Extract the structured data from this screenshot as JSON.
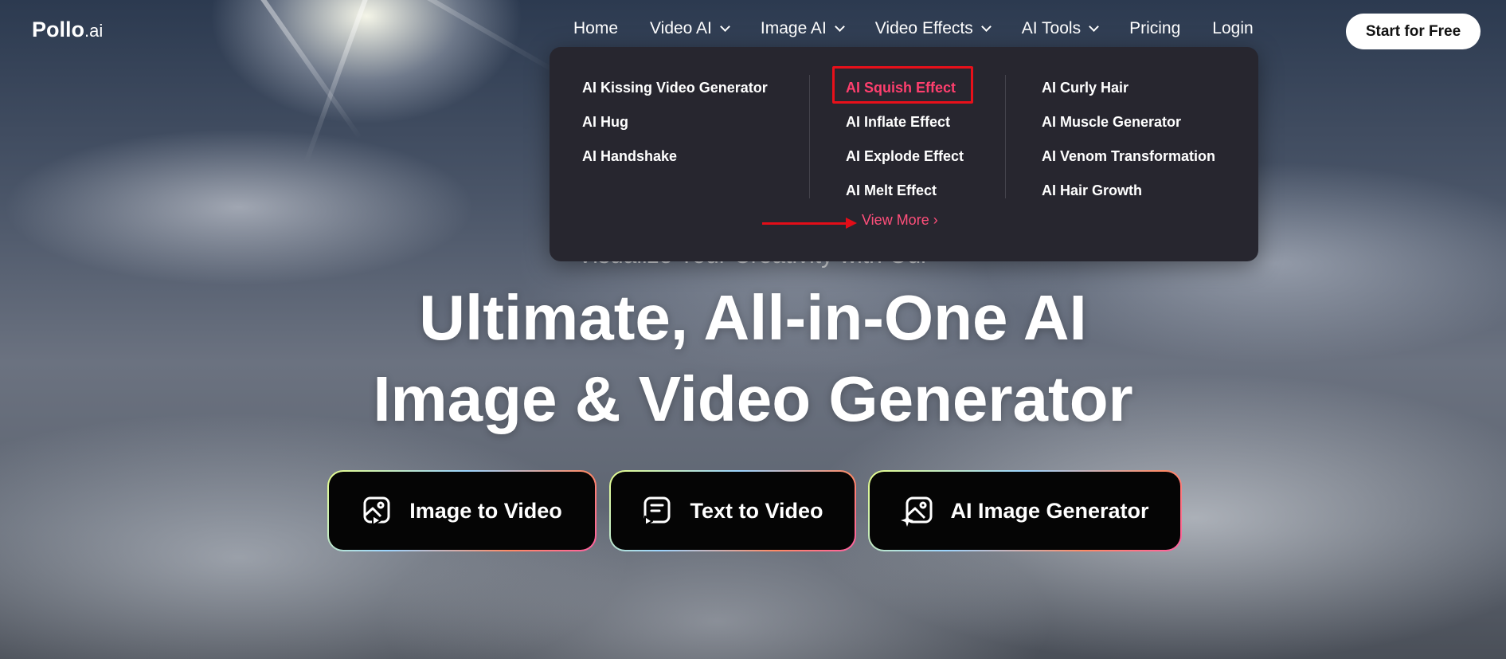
{
  "header": {
    "logo": {
      "main": "Pollo",
      "suffix": ".ai"
    },
    "nav": [
      {
        "label": "Home",
        "has_dropdown": false
      },
      {
        "label": "Video AI",
        "has_dropdown": true
      },
      {
        "label": "Image AI",
        "has_dropdown": true
      },
      {
        "label": "Video Effects",
        "has_dropdown": true
      },
      {
        "label": "AI Tools",
        "has_dropdown": true
      },
      {
        "label": "Pricing",
        "has_dropdown": false
      },
      {
        "label": "Login",
        "has_dropdown": false
      }
    ],
    "cta_label": "Start for Free"
  },
  "dropdown": {
    "columns": [
      [
        "AI Kissing Video Generator",
        "AI Hug",
        "AI Handshake"
      ],
      [
        "AI Squish Effect",
        "AI Inflate Effect",
        "AI Explode Effect",
        "AI Melt Effect"
      ],
      [
        "AI Curly Hair",
        "AI Muscle Generator",
        "AI Venom Transformation",
        "AI Hair Growth"
      ]
    ],
    "highlighted_item": "AI Squish Effect",
    "view_more": "View More ›"
  },
  "hero": {
    "tagline": "Visualize Your Creativity with Our",
    "headline_line1": "Ultimate, All-in-One AI",
    "headline_line2": "Image & Video Generator",
    "buttons": [
      {
        "label": "Image to Video",
        "icon": "image-to-video-icon"
      },
      {
        "label": "Text to Video",
        "icon": "text-to-video-icon"
      },
      {
        "label": "AI Image Generator",
        "icon": "ai-image-icon"
      }
    ]
  },
  "colors": {
    "dropdown_bg": "#27262f",
    "highlight_text": "#ff3f6e",
    "annotation_red": "#e30d18"
  }
}
